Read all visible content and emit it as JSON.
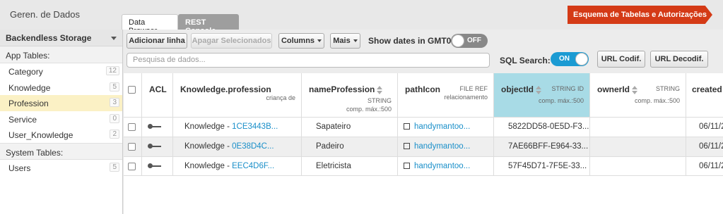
{
  "app": {
    "title": "Geren. de Dados"
  },
  "tabs": [
    {
      "label": "Data Browser"
    },
    {
      "label": "REST Console"
    }
  ],
  "schema_button": "Esquema de Tabelas e Autorizações",
  "sidebar": {
    "storage": "Backendless Storage",
    "app_tables_label": "App Tables:",
    "app_tables": [
      {
        "name": "Category",
        "count": "12"
      },
      {
        "name": "Knowledge",
        "count": "5"
      },
      {
        "name": "Profession",
        "count": "3"
      },
      {
        "name": "Service",
        "count": "0"
      },
      {
        "name": "User_Knowledge",
        "count": "2"
      }
    ],
    "system_tables_label": "System Tables:",
    "system_tables": [
      {
        "name": "Users",
        "count": "5"
      }
    ]
  },
  "toolbar": {
    "add_row": "Adicionar linha",
    "delete_selected": "Apagar Selecionados",
    "columns": "Columns",
    "more": "Mais",
    "show_dates_label": "Show dates in GMT0:",
    "show_dates_state": "OFF",
    "search_placeholder": "Pesquisa de dados...",
    "sql_search_label": "SQL Search:",
    "sql_search_state": "ON",
    "url_encode": "URL Codif.",
    "url_decode": "URL Decodif."
  },
  "columns": [
    {
      "title": "ACL"
    },
    {
      "title": "Knowledge.profession",
      "sub": "criança de"
    },
    {
      "title": "nameProfession",
      "sub1": "STRING",
      "sub2": "comp. máx.:500"
    },
    {
      "title": "pathIcon",
      "sub1": "FILE REF",
      "sub2": "relacionamento"
    },
    {
      "title": "objectId",
      "sub1": "STRING ID",
      "sub2": "comp. máx.:500"
    },
    {
      "title": "ownerId",
      "sub1": "STRING",
      "sub2": "comp. máx.:500"
    },
    {
      "title": "created"
    }
  ],
  "rows": [
    {
      "rel_prefix": "Knowledge - ",
      "rel_link": "1CE3443B...",
      "name": "Sapateiro",
      "icon": "handymantoo...",
      "objectId": "5822DD58-0E5D-F3...",
      "ownerId": "",
      "created": "06/11/2"
    },
    {
      "rel_prefix": "Knowledge - ",
      "rel_link": "0E38D4C...",
      "name": "Padeiro",
      "icon": "handymantoo...",
      "objectId": "7AE66BFF-E964-33...",
      "ownerId": "",
      "created": "06/11/2"
    },
    {
      "rel_prefix": "Knowledge - ",
      "rel_link": "EEC4D6F...",
      "name": "Eletricista",
      "icon": "handymantoo...",
      "objectId": "57F45D71-7F5E-33...",
      "ownerId": "",
      "created": "06/11/2"
    }
  ]
}
